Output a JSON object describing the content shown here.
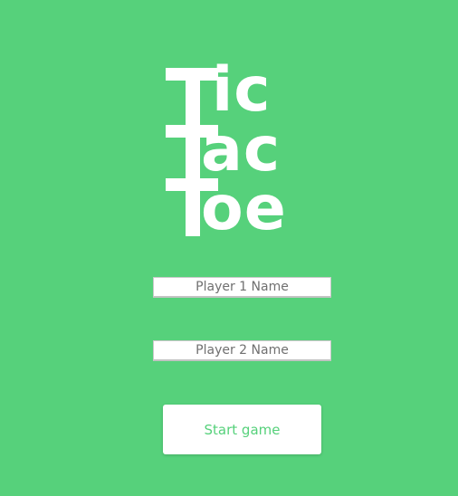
{
  "logo": {
    "line1": "ic",
    "line2": "ac",
    "line3": "oe",
    "line4": "T"
  },
  "form": {
    "player1_placeholder": "Player 1 Name",
    "player2_placeholder": "Player 2 Name",
    "start_label": "Start game"
  },
  "colors": {
    "background": "#56d17b",
    "foreground": "#ffffff",
    "accent": "#56d17b"
  }
}
